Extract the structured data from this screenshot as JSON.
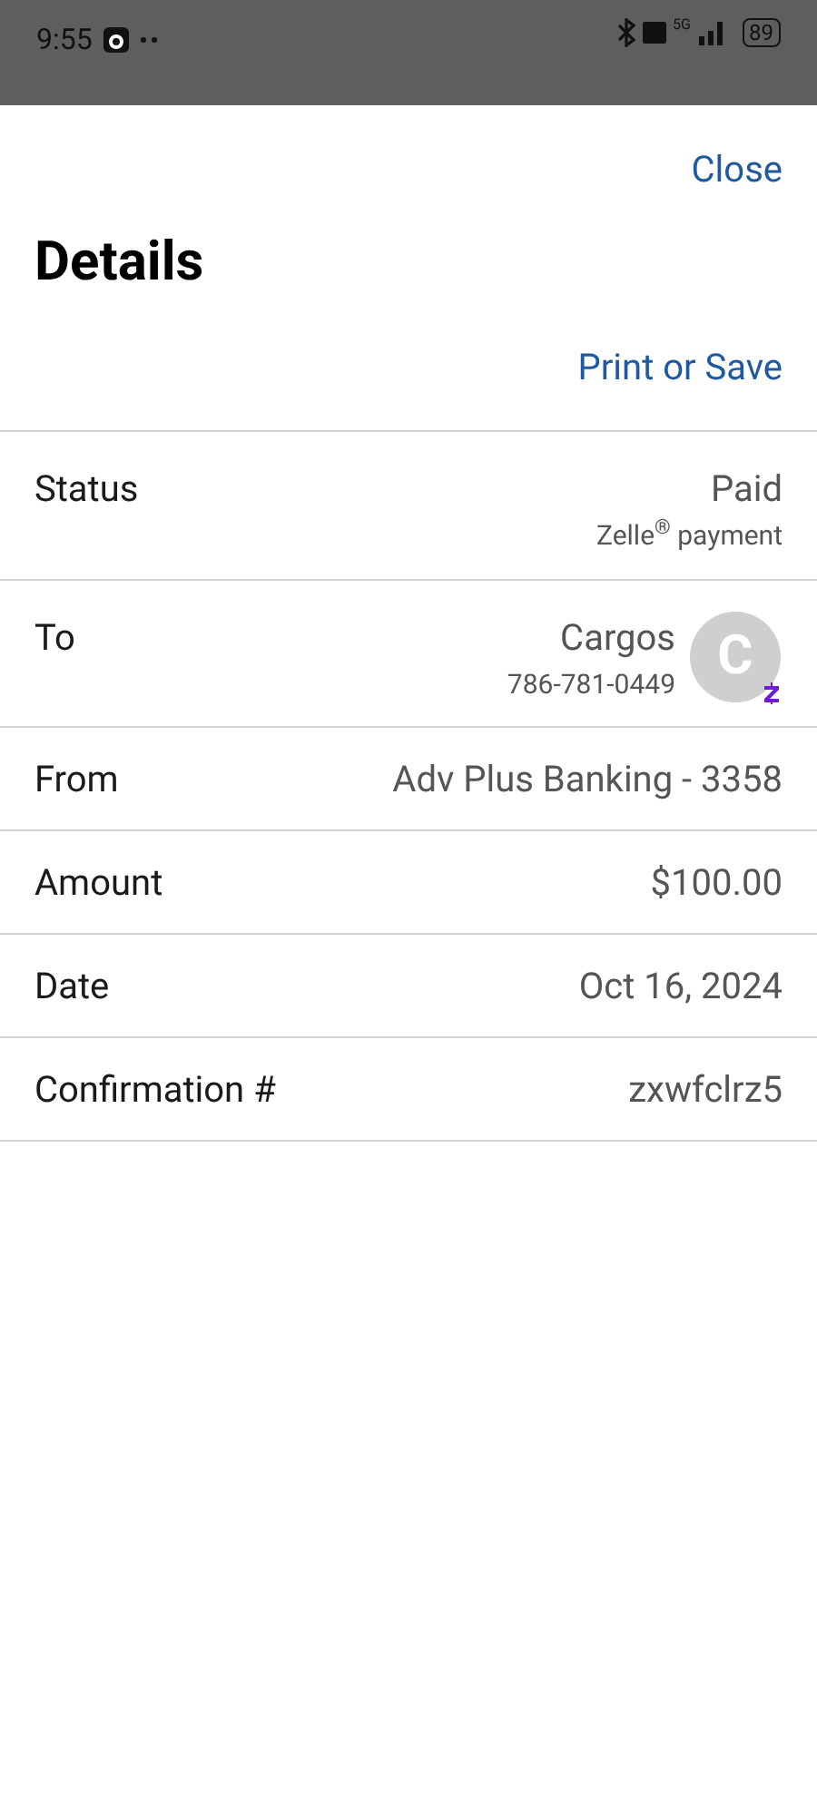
{
  "status_bar": {
    "time": "9:55",
    "battery": "89",
    "network": "5G"
  },
  "sheet": {
    "close": "Close",
    "title": "Details",
    "print": "Print or Save"
  },
  "rows": [
    {
      "kind": "status",
      "label": "Status",
      "value": "Paid",
      "sub": "Zelle$^{®}$ payment"
    },
    {
      "kind": "payee",
      "label": "To",
      "value": "Cargos",
      "sub": "786-781-0449",
      "initial": "C"
    },
    {
      "kind": "plain",
      "label": "From",
      "value": "Adv Plus Banking - 3358"
    },
    {
      "kind": "plain",
      "label": "Amount",
      "value": "$100.00"
    },
    {
      "kind": "plain",
      "label": "Date",
      "value": "Oct 16, 2024"
    },
    {
      "kind": "plain",
      "label": "Confirmation #",
      "value": "zxwfclrz5"
    }
  ]
}
